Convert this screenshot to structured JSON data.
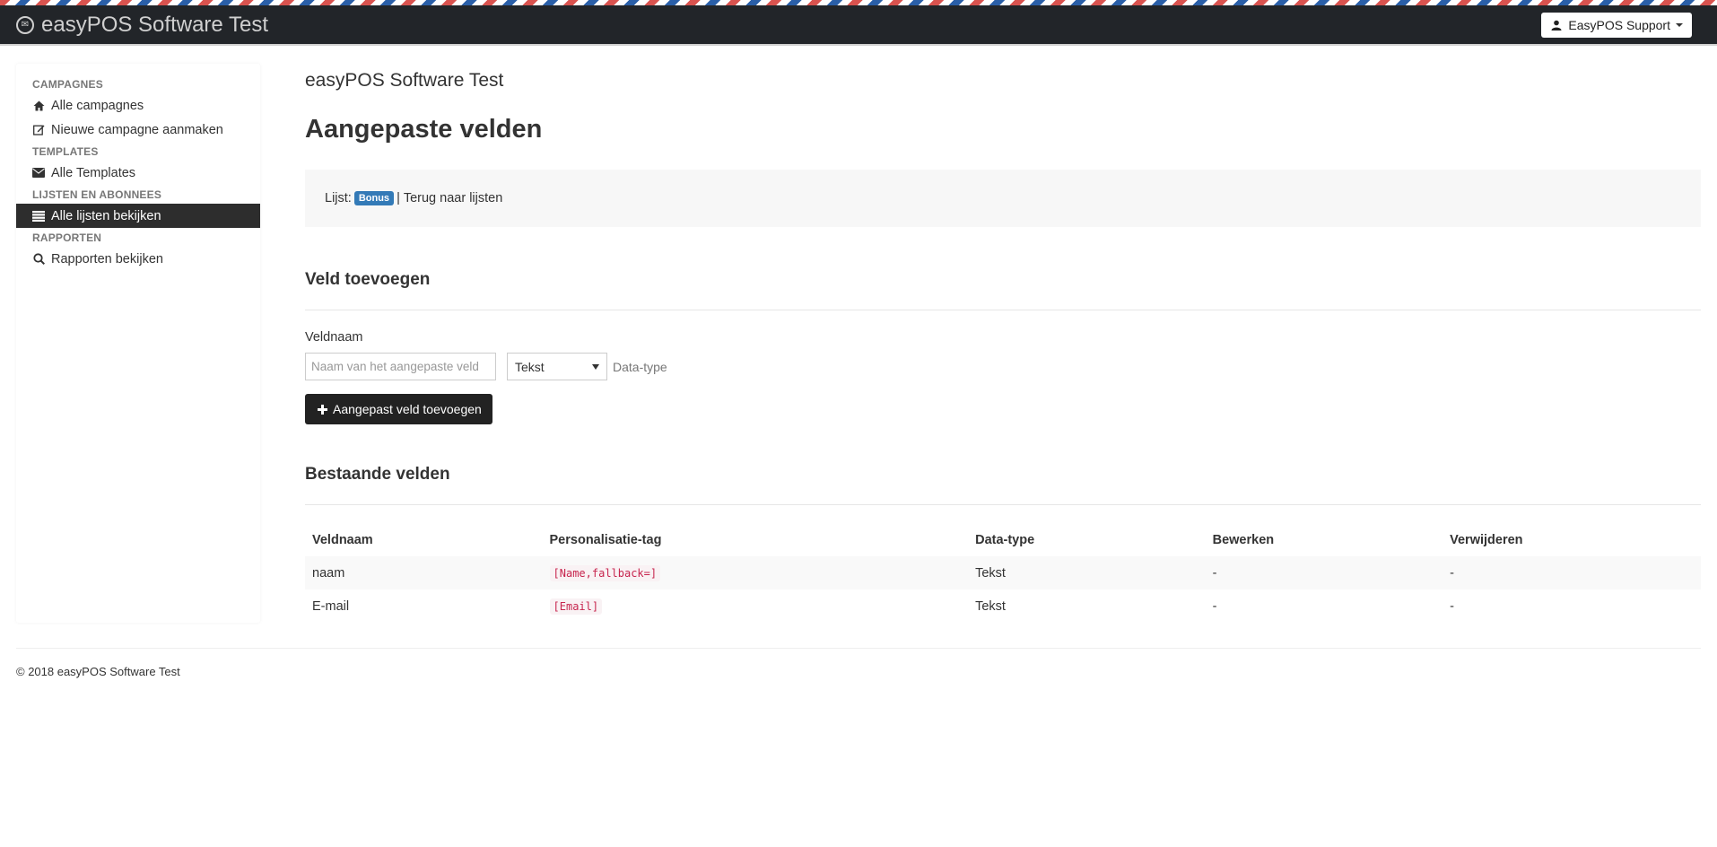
{
  "navbar": {
    "brand": "easyPOS Software Test",
    "user": "EasyPOS Support"
  },
  "sidebar": {
    "sections": [
      {
        "heading": "CAMPAGNES"
      },
      {
        "heading": "TEMPLATES"
      },
      {
        "heading": "LIJSTEN EN ABONNEES"
      },
      {
        "heading": "RAPPORTEN"
      }
    ],
    "items": [
      {
        "label": "Alle campagnes",
        "icon": "home-icon"
      },
      {
        "label": "Nieuwe campagne aanmaken",
        "icon": "edit-icon"
      },
      {
        "label": "Alle Templates",
        "icon": "envelope-icon"
      },
      {
        "label": "Alle lijsten bekijken",
        "icon": "list-icon",
        "active": true
      },
      {
        "label": "Rapporten bekijken",
        "icon": "search-icon"
      }
    ]
  },
  "main": {
    "site_title": "easyPOS Software Test",
    "page_title": "Aangepaste velden",
    "list_prefix": "Lijst:",
    "list_badge": "Bonus",
    "list_sep": "|",
    "back_link": "Terug naar lijsten",
    "add_section": "Veld toevoegen",
    "field_label": "Veldnaam",
    "field_placeholder": "Naam van het aangepaste veld",
    "data_type_value": "Tekst",
    "data_type_help": "Data-type",
    "add_button": "Aangepast veld toevoegen",
    "existing_section": "Bestaande velden",
    "table": {
      "headers": [
        "Veldnaam",
        "Personalisatie-tag",
        "Data-type",
        "Bewerken",
        "Verwijderen"
      ],
      "rows": [
        [
          "naam",
          "[Name,fallback=]",
          "Tekst",
          "-",
          "-"
        ],
        [
          "E-mail",
          "[Email]",
          "Tekst",
          "-",
          "-"
        ]
      ]
    }
  },
  "footer": {
    "text": "© 2018 easyPOS Software Test"
  }
}
